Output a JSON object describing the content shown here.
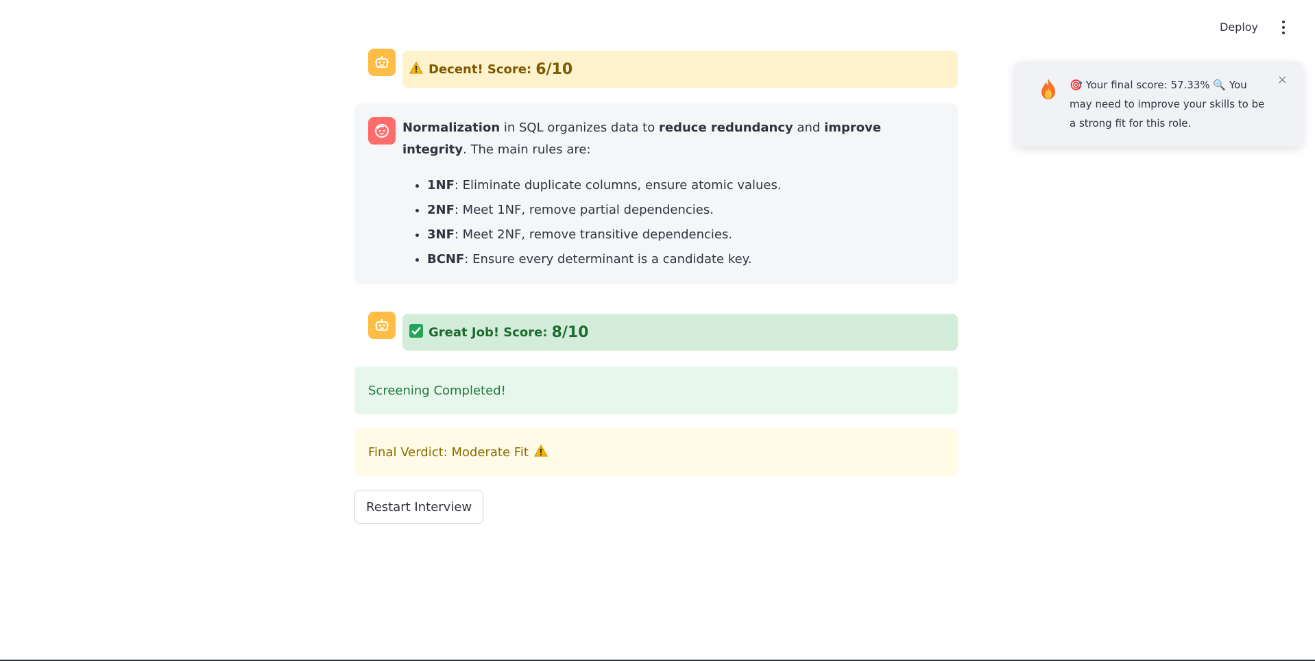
{
  "header": {
    "deploy_label": "Deploy"
  },
  "toast": {
    "message": "🎯 Your final score: 57.33% 🔍 You may need to improve your skills to be a strong fit for this role.",
    "close_glyph": "×"
  },
  "messages": [
    {
      "role": "assistant",
      "label": "Decent! Score:",
      "score": "6/10"
    },
    {
      "role": "user",
      "intro": {
        "term": "Normalization",
        "part1": " in SQL organizes data to ",
        "bold1": "reduce redundancy",
        "part2": " and ",
        "bold2": "improve integrity",
        "part3": ". The main rules are:"
      },
      "rules": [
        {
          "name": "1NF",
          "text": ": Eliminate duplicate columns, ensure atomic values."
        },
        {
          "name": "2NF",
          "text": ": Meet 1NF, remove partial dependencies."
        },
        {
          "name": "3NF",
          "text": ": Meet 2NF, remove transitive dependencies."
        },
        {
          "name": "BCNF",
          "text": ": Ensure every determinant is a candidate key."
        }
      ]
    },
    {
      "role": "assistant",
      "label": "Great Job! Score:",
      "score": "8/10"
    }
  ],
  "status": {
    "completed": "Screening Completed!",
    "verdict": "Final Verdict: Moderate Fit",
    "verdict_icon": "⚠️"
  },
  "actions": {
    "restart_label": "Restart Interview"
  },
  "colors": {
    "bot_avatar": "#ffbd45",
    "user_avatar": "#ff6c6c",
    "warning_bg": "#fff3cd",
    "success_bg": "#d4edda"
  }
}
